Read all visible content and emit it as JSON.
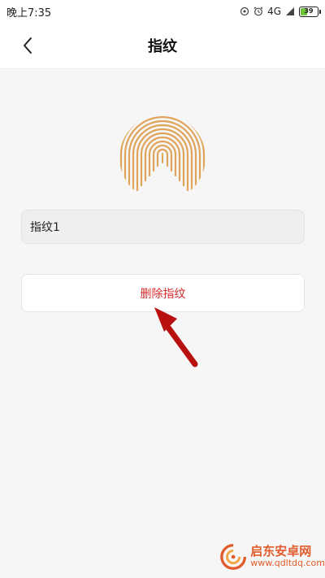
{
  "status_bar": {
    "time": "晚上7:35",
    "network": "4G",
    "battery": "39"
  },
  "nav": {
    "title": "指纹"
  },
  "fingerprint_entry": {
    "name": "指纹1"
  },
  "actions": {
    "delete_label": "删除指纹"
  },
  "watermark": {
    "name": "启东安卓网",
    "url": "www.qdltdq.com"
  },
  "colors": {
    "fingerprint": "#e0a35a",
    "delete_text": "#d42d2d",
    "arrow": "#b80f0f",
    "watermark": "#e25b2c"
  }
}
